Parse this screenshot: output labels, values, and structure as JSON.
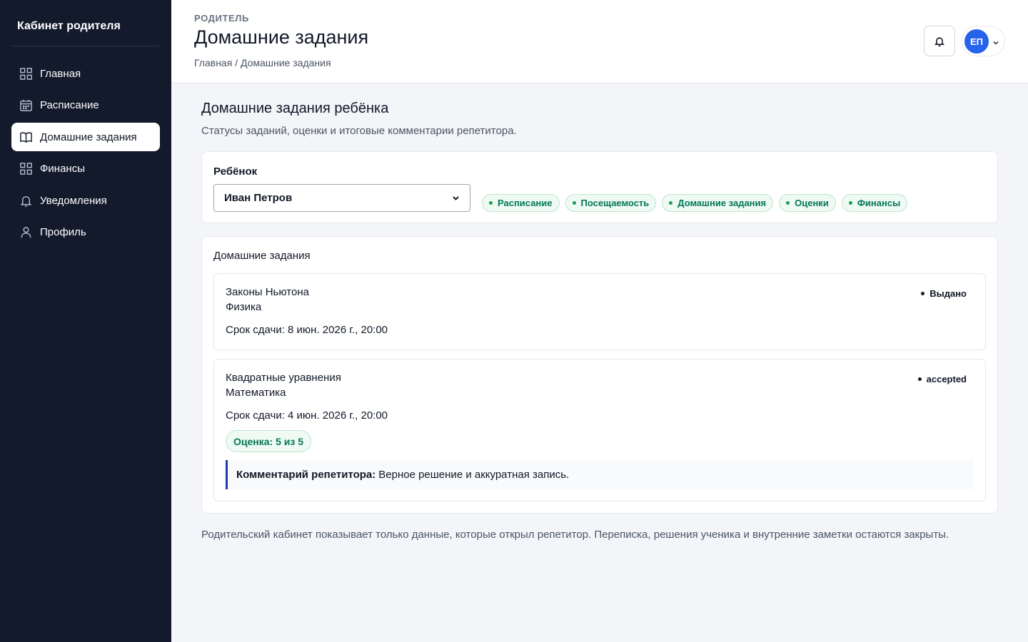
{
  "sidebar": {
    "brand": "Кабинет родителя",
    "items": [
      {
        "label": "Главная",
        "icon": "grid-icon"
      },
      {
        "label": "Расписание",
        "icon": "calendar-icon"
      },
      {
        "label": "Домашние задания",
        "icon": "book-icon",
        "active": true
      },
      {
        "label": "Финансы",
        "icon": "grid-icon"
      },
      {
        "label": "Уведомления",
        "icon": "bell-icon"
      },
      {
        "label": "Профиль",
        "icon": "user-icon"
      }
    ]
  },
  "header": {
    "eyebrow": "РОДИТЕЛЬ",
    "title": "Домашние задания",
    "breadcrumb": "Главная / Домашние задания",
    "avatar_initials": "ЕП"
  },
  "section": {
    "title": "Домашние задания ребёнка",
    "subtitle": "Статусы заданий, оценки и итоговые комментарии репетитора."
  },
  "child_picker": {
    "label": "Ребёнок",
    "selected": "Иван Петров",
    "tags": [
      "Расписание",
      "Посещаемость",
      "Домашние задания",
      "Оценки",
      "Финансы"
    ]
  },
  "homework": {
    "heading": "Домашние задания",
    "items": [
      {
        "name": "Законы Ньютона",
        "subject": "Физика",
        "due": "Срок сдачи: 8 июн. 2026 г., 20:00",
        "status": "Выдано"
      },
      {
        "name": "Квадратные уравнения",
        "subject": "Математика",
        "due": "Срок сдачи: 4 июн. 2026 г., 20:00",
        "status": "accepted",
        "grade": "Оценка: 5 из 5",
        "comment_label": "Комментарий репетитора:",
        "comment_text": "Верное решение и аккуратная запись."
      }
    ]
  },
  "footer_note": "Родительский кабинет показывает только данные, которые открыл репетитор. Переписка, решения ученика и внутренние заметки остаются закрыты.",
  "colors": {
    "sidebar_bg": "#131a2c",
    "accent": "#2563eb",
    "success": "#047857",
    "comment_border": "#1e40af"
  }
}
